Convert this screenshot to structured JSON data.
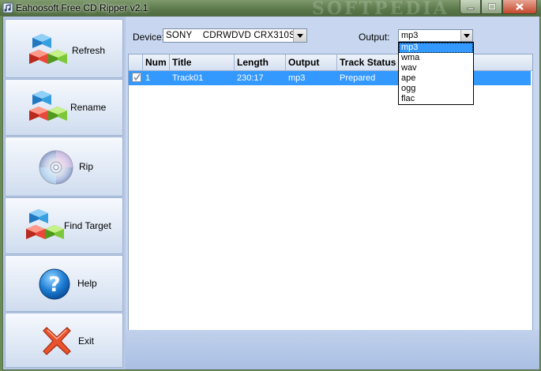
{
  "window": {
    "title": "Eahoosoft Free CD Ripper v2.1",
    "watermark": "SOFTPEDIA"
  },
  "sidebar": {
    "buttons": [
      {
        "label": "Refresh",
        "icon": "cubes-icon"
      },
      {
        "label": "Rename",
        "icon": "cubes-icon"
      },
      {
        "label": "Rip",
        "icon": "cd-disc-icon"
      },
      {
        "label": "Find Target",
        "icon": "cubes-icon"
      },
      {
        "label": "Help",
        "icon": "help-icon"
      },
      {
        "label": "Exit",
        "icon": "exit-x-icon"
      }
    ]
  },
  "main": {
    "device_label": "Device:",
    "device_value": "SONY    CDRWDVD CRX310S",
    "output_label": "Output:",
    "output_value": "mp3",
    "output_options": [
      "mp3",
      "wma",
      "wav",
      "ape",
      "ogg",
      "flac"
    ],
    "table": {
      "columns": [
        "",
        "Num",
        "Title",
        "Length",
        "Output",
        "Track Status"
      ],
      "rows": [
        {
          "checked": true,
          "num": "1",
          "title": "Track01",
          "length": "230:17",
          "output": "mp3",
          "status": "Prepared"
        }
      ]
    }
  },
  "colors": {
    "selection": "#3399ff",
    "panel": "#c8d7ef",
    "titlebar": "#5c7a4b"
  }
}
